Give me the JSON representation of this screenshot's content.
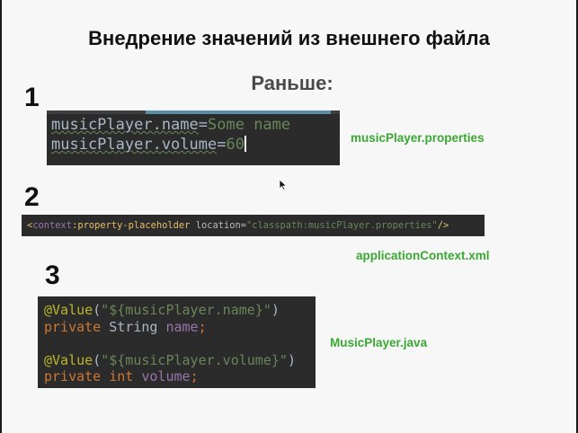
{
  "title": "Внедрение значений из внешнего файла",
  "subtitle": "Раньше:",
  "steps": [
    "1",
    "2",
    "3"
  ],
  "block1": {
    "line1": {
      "key": "musicPlayer.name",
      "eq": "=",
      "value": "Some name"
    },
    "line2": {
      "key": "musicPlayer.volume",
      "eq": "=",
      "value": "60"
    }
  },
  "block2": {
    "open": "<",
    "ns": "context",
    "colon": ":",
    "tag": "property-placeholder",
    "attr": " location=",
    "value": "\"classpath:musicPlayer.properties\"",
    "close": "/>"
  },
  "block3": {
    "ann1": "@Value",
    "paren_open": "(",
    "str1": "\"${musicPlayer.name}\"",
    "paren_close": ")",
    "kw_private": "private",
    "type_string": " String ",
    "field_name": "name",
    "semi": ";",
    "ann2": "@Value",
    "str2": "\"${musicPlayer.volume}\"",
    "kw_int": " int ",
    "field_volume": "volume"
  },
  "labels": {
    "file1": "musicPlayer.properties",
    "file2": "applicationContext.xml",
    "file3": "MusicPlayer.java"
  },
  "colors": {
    "label_green": "#3aa832",
    "code_bg": "#2b2b2b"
  }
}
